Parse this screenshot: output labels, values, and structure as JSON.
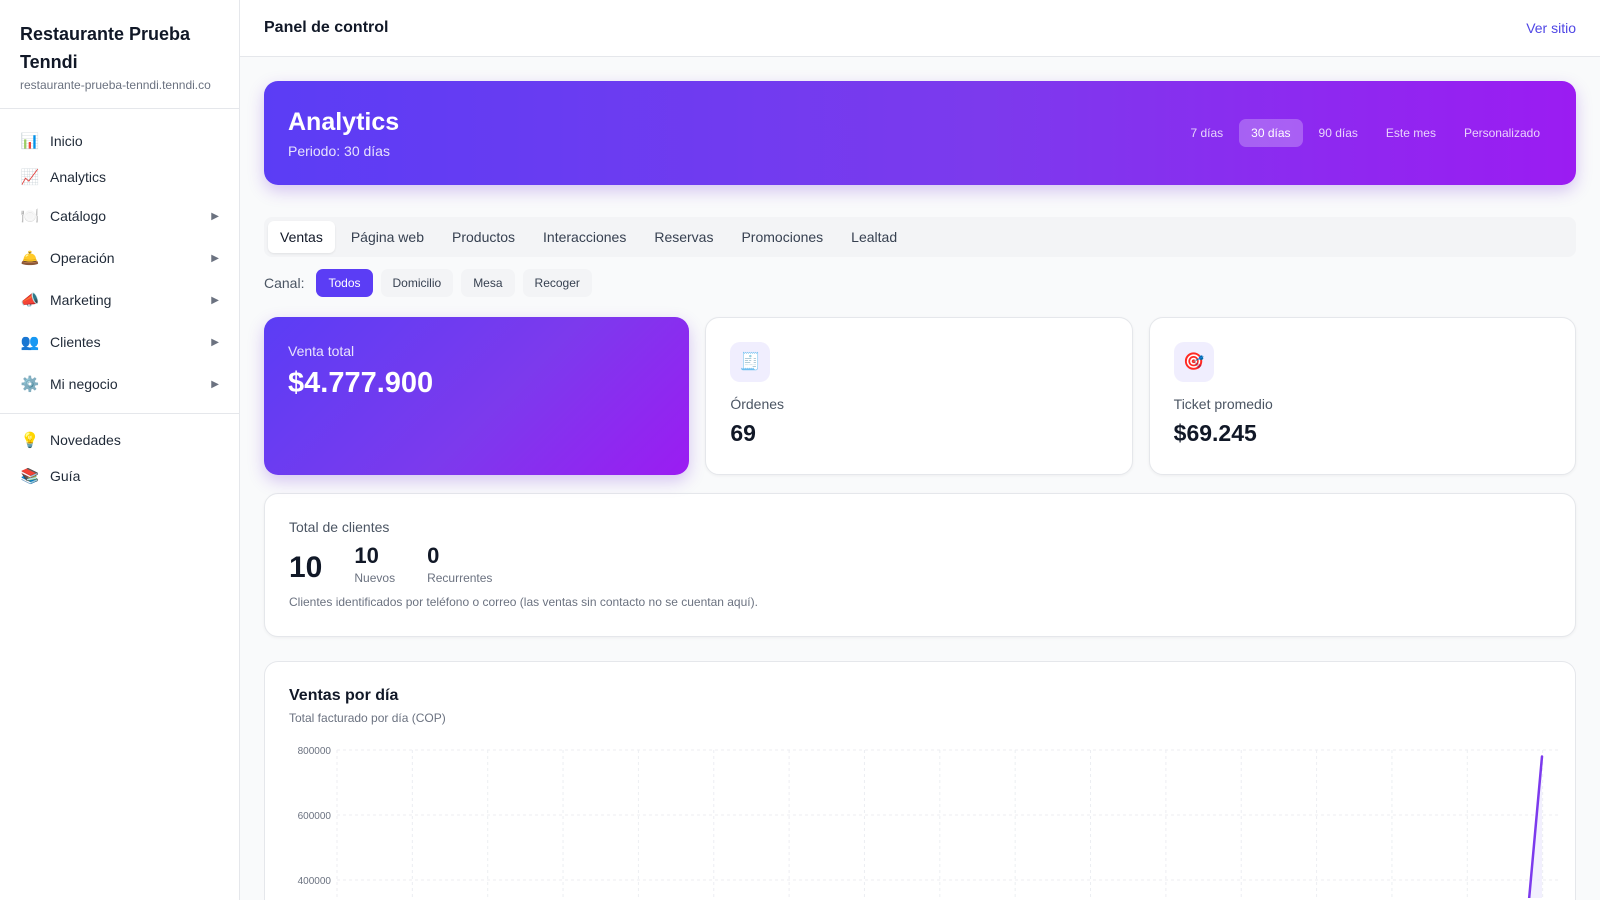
{
  "sidebar": {
    "brand_name": "Restaurante Prueba Tenndi",
    "brand_url": "restaurante-prueba-tenndi.tenndi.co",
    "items": [
      {
        "label": "Inicio",
        "icon": "📊",
        "icon_name": "bar-chart-icon",
        "expandable": false
      },
      {
        "label": "Analytics",
        "icon": "📈",
        "icon_name": "trend-chart-icon",
        "expandable": false
      },
      {
        "label": "Catálogo",
        "icon": "🍽️",
        "icon_name": "plate-icon",
        "expandable": true
      },
      {
        "label": "Operación",
        "icon": "🛎️",
        "icon_name": "service-bell-icon",
        "expandable": true
      },
      {
        "label": "Marketing",
        "icon": "📣",
        "icon_name": "megaphone-icon",
        "expandable": true
      },
      {
        "label": "Clientes",
        "icon": "👥",
        "icon_name": "users-icon",
        "expandable": true
      },
      {
        "label": "Mi negocio",
        "icon": "⚙️",
        "icon_name": "gear-icon",
        "expandable": true
      }
    ],
    "bottom_items": [
      {
        "label": "Novedades",
        "icon": "💡",
        "icon_name": "lightbulb-icon"
      },
      {
        "label": "Guía",
        "icon": "📚",
        "icon_name": "books-icon"
      }
    ]
  },
  "header": {
    "title": "Panel de control",
    "view_site": "Ver sitio"
  },
  "hero": {
    "title": "Analytics",
    "period": "Periodo: 30 días",
    "ranges": [
      "7 días",
      "30 días",
      "90 días",
      "Este mes",
      "Personalizado"
    ],
    "active_range": "30 días"
  },
  "tabs": {
    "items": [
      "Ventas",
      "Página web",
      "Productos",
      "Interacciones",
      "Reservas",
      "Promociones",
      "Lealtad"
    ],
    "active": "Ventas"
  },
  "channel": {
    "label": "Canal:",
    "options": [
      "Todos",
      "Domicilio",
      "Mesa",
      "Recoger"
    ],
    "active": "Todos"
  },
  "kpis": {
    "total_sales": {
      "label": "Venta total",
      "value": "$4.777.900"
    },
    "orders": {
      "label": "Órdenes",
      "value": "69",
      "icon": "🧾",
      "icon_name": "receipt-icon"
    },
    "avg_ticket": {
      "label": "Ticket promedio",
      "value": "$69.245",
      "icon": "🎯",
      "icon_name": "target-icon"
    }
  },
  "clients": {
    "title": "Total de clientes",
    "total": "10",
    "new_value": "10",
    "new_label": "Nuevos",
    "returning_value": "0",
    "returning_label": "Recurrentes",
    "note": "Clientes identificados por teléfono o correo (las ventas sin contacto no se cuentan aquí)."
  },
  "colors": {
    "accent": "#5b3df5",
    "accent_end": "#9b1cf2",
    "line": "#7c3aed"
  },
  "chart_data": {
    "type": "area",
    "title": "Ventas por día",
    "subtitle": "Total facturado por día (COP)",
    "ylabel": "",
    "xlabel": "",
    "y_ticks": [
      400000,
      600000,
      800000
    ],
    "grid": true,
    "x_count": 31,
    "last_value": 780000
  }
}
